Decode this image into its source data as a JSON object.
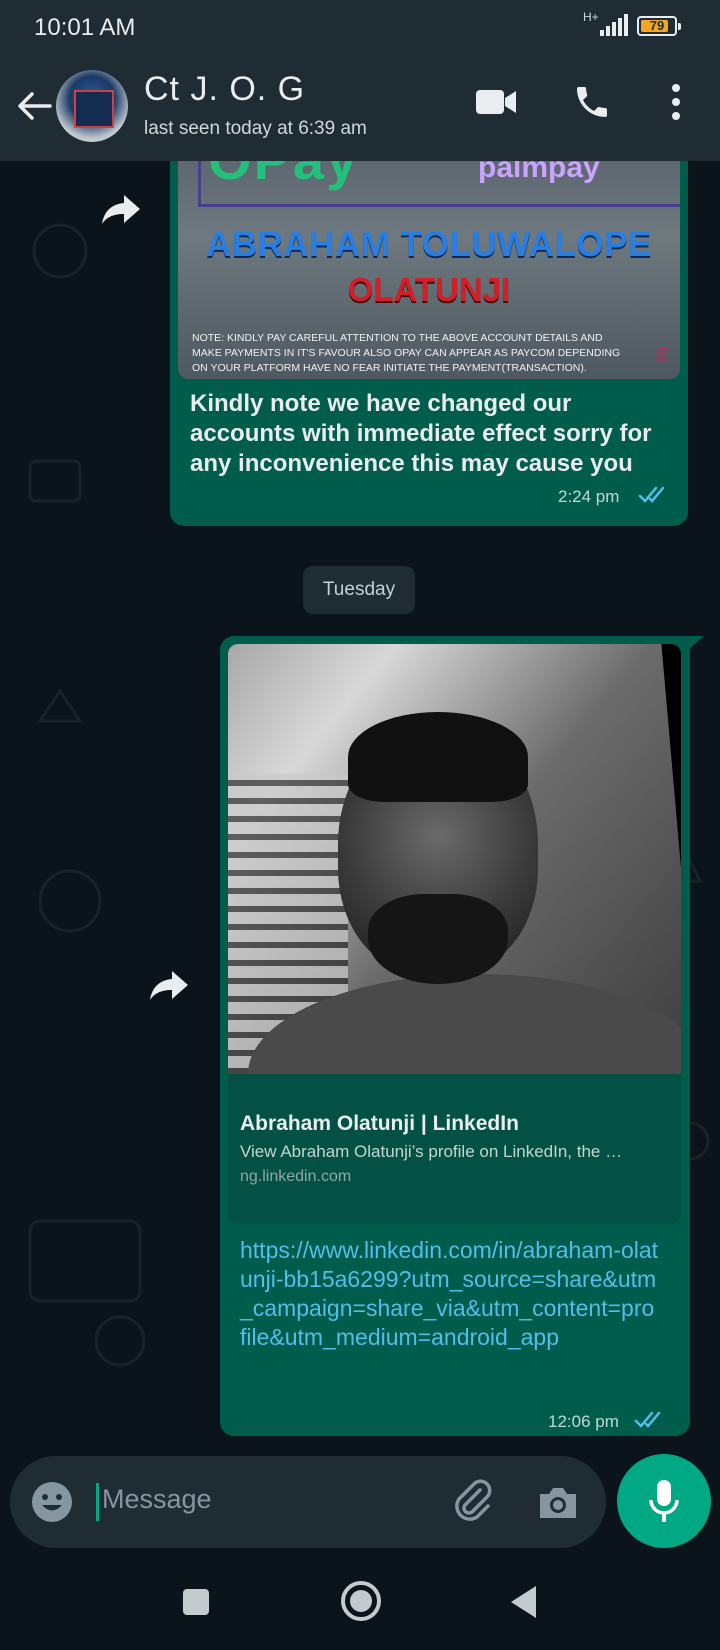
{
  "status_bar": {
    "time": "10:01 AM",
    "network": "H+",
    "battery": "79"
  },
  "header": {
    "contact_name": "Ct J. O. G",
    "contact_status": "last seen today at 6:39 am"
  },
  "messages": [
    {
      "image": {
        "brand_left": "OPay",
        "brand_right": "palmpay",
        "name_line1": "ABRAHAM TOLUWALOPE",
        "name_line2": "OLATUNJI",
        "note": "NOTE: Kindly pay careful attention to the above account details and make payments in it's favour also opay can appear as paycom depending on your platform have no fear initiate the payment(transaction)."
      },
      "text": "Kindly note we have changed our accounts with immediate effect sorry for any inconvenience this may cause you",
      "time": "2:24 pm"
    },
    {
      "link_preview": {
        "title": "Abraham Olatunji | LinkedIn",
        "description": "View Abraham Olatunji’s profile on LinkedIn, the …",
        "domain": "ng.linkedin.com"
      },
      "text": "https://www.linkedin.com/in/abraham-olatunji-bb15a6299?utm_source=share&utm_campaign=share_via&utm_content=profile&utm_medium=android_app",
      "time": "12:06 pm"
    }
  ],
  "date_divider": "Tuesday",
  "input": {
    "placeholder": "Message"
  },
  "colors": {
    "accent": "#00a884",
    "outgoing_bubble": "#005c4b",
    "read_ticks": "#53bdeb",
    "header": "#1f2c34"
  },
  "icons": [
    "back-arrow-icon",
    "video-call-icon",
    "voice-call-icon",
    "more-options-icon",
    "forward-icon",
    "double-check-icon",
    "emoji-icon",
    "attach-icon",
    "camera-icon",
    "mic-icon",
    "recent-apps-icon",
    "home-icon",
    "back-nav-icon"
  ]
}
